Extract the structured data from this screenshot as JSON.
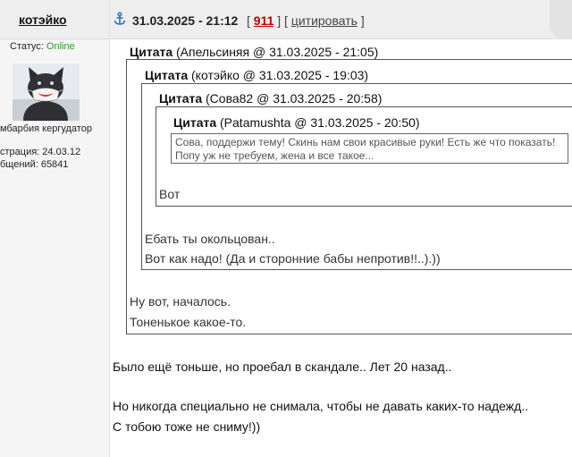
{
  "header": {
    "username": "котэйко",
    "post_date": "31.03.2025 - 21:12",
    "post_number": "911",
    "quote_label": "цитировать"
  },
  "sidebar": {
    "status_label": "Статус:",
    "status_value": "Online",
    "user_title": "мбарбия кергудатор",
    "registration": "страция: 24.03.12",
    "posts": "бщений: 65841"
  },
  "quotes": [
    {
      "label": "Цитата",
      "meta": "(Апельсиняя @ 31.03.2025 - 21:05)",
      "lines": [
        "Ну вот, началось.",
        "Тоненькое какое-то."
      ]
    },
    {
      "label": "Цитата",
      "meta": "(котэйко @ 31.03.2025 - 19:03)",
      "lines": [
        "Ебать ты окольцован..",
        "Вот как надо! (Да и сторонние бабы непротив!!..).))"
      ]
    },
    {
      "label": "Цитата",
      "meta": "(Сова82 @ 31.03.2025 - 20:58)",
      "lines": [
        "Вот"
      ]
    },
    {
      "label": "Цитата",
      "meta": "(Patamushta @ 31.03.2025 - 20:50)",
      "lines": [
        "Сова, поддержи тему! Скинь нам свои красивые руки! Есть же что показать!",
        "Попу уж не требуем, жена и все такое..."
      ]
    }
  ],
  "post_body": [
    "Было ещё тоньше, но проебал в скандале.. Лет 20 назад..",
    "",
    "Но никогда специально не снимала, чтобы не давать каких-то надежд..",
    "С тобою тоже не сниму!))"
  ],
  "icons": {
    "post_link": "anchor-icon"
  },
  "colors": {
    "post_number": "#c00000",
    "online": "#2e9a2e"
  }
}
